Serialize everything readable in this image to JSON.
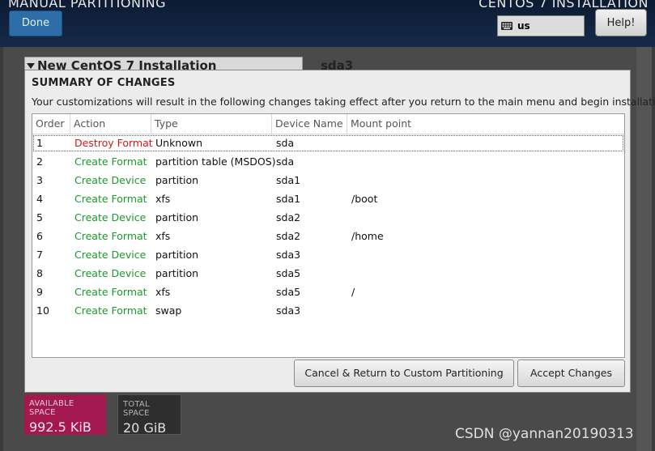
{
  "header": {
    "page_title": "MANUAL PARTITIONING",
    "product_title": "CENTOS 7 INSTALLATION",
    "done_label": "Done",
    "keyboard_layout": "us",
    "help_label": "Help!"
  },
  "background": {
    "panel_title": "New CentOS 7 Installation",
    "selected_device": "sda3",
    "available_space": {
      "label": "AVAILABLE SPACE",
      "value": "992.5 KiB"
    },
    "total_space": {
      "label": "TOTAL SPACE",
      "value": "20 GiB"
    }
  },
  "dialog": {
    "title": "SUMMARY OF CHANGES",
    "description": "Your customizations will result in the following changes taking effect after you return to the main menu and begin installation:",
    "columns": [
      "Order",
      "Action",
      "Type",
      "Device Name",
      "Mount point"
    ],
    "rows": [
      {
        "order": "1",
        "action": "Destroy Format",
        "type": "Unknown",
        "device": "sda",
        "mount": ""
      },
      {
        "order": "2",
        "action": "Create Format",
        "type": "partition table (MSDOS)",
        "device": "sda",
        "mount": ""
      },
      {
        "order": "3",
        "action": "Create Device",
        "type": "partition",
        "device": "sda1",
        "mount": ""
      },
      {
        "order": "4",
        "action": "Create Format",
        "type": "xfs",
        "device": "sda1",
        "mount": "/boot"
      },
      {
        "order": "5",
        "action": "Create Device",
        "type": "partition",
        "device": "sda2",
        "mount": ""
      },
      {
        "order": "6",
        "action": "Create Format",
        "type": "xfs",
        "device": "sda2",
        "mount": "/home"
      },
      {
        "order": "7",
        "action": "Create Device",
        "type": "partition",
        "device": "sda3",
        "mount": ""
      },
      {
        "order": "8",
        "action": "Create Device",
        "type": "partition",
        "device": "sda5",
        "mount": ""
      },
      {
        "order": "9",
        "action": "Create Format",
        "type": "xfs",
        "device": "sda5",
        "mount": "/"
      },
      {
        "order": "10",
        "action": "Create Format",
        "type": "swap",
        "device": "sda3",
        "mount": ""
      }
    ],
    "cancel_label": "Cancel & Return to Custom Partitioning",
    "accept_label": "Accept Changes"
  },
  "watermark": "CSDN @yannan20190313",
  "colors": {
    "create_action": "#1a9a2a",
    "destroy_action": "#d01818",
    "available_space_bg": "#a3184f"
  }
}
